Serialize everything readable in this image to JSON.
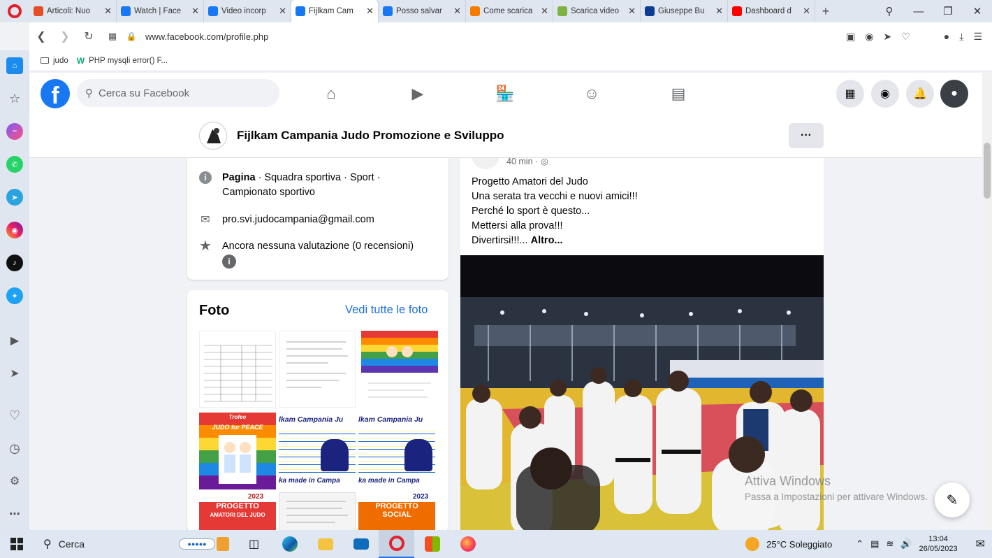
{
  "browser": {
    "tabs": [
      {
        "title": "Articoli: Nuo",
        "favicon": "joomla-icon",
        "color": "#e44d26",
        "active": false
      },
      {
        "title": "Watch | Face",
        "favicon": "facebook-icon",
        "color": "#1877f2",
        "active": false
      },
      {
        "title": "Video incorp",
        "favicon": "facebook-icon",
        "color": "#1877f2",
        "active": false
      },
      {
        "title": "Fijlkam Cam",
        "favicon": "facebook-icon",
        "color": "#1877f2",
        "active": true
      },
      {
        "title": "Posso salvar",
        "favicon": "facebook-icon",
        "color": "#1877f2",
        "active": false
      },
      {
        "title": "Come scarica",
        "favicon": "a-icon",
        "color": "#f57c00",
        "active": false
      },
      {
        "title": "Scarica video",
        "favicon": "android-icon",
        "color": "#7cb342",
        "active": false
      },
      {
        "title": "Giuseppe Bu",
        "favicon": "rai-icon",
        "color": "#0b3d91",
        "active": false
      },
      {
        "title": "Dashboard d",
        "favicon": "youtube-icon",
        "color": "#ff0000",
        "active": false
      }
    ],
    "url": "www.facebook.com/profile.php",
    "bookmarks": [
      {
        "label": "judo",
        "icon": "folder-icon"
      },
      {
        "label": "PHP mysqli error() F...",
        "icon": "w3schools-icon"
      }
    ]
  },
  "facebook": {
    "search_placeholder": "Cerca su Facebook",
    "page_name": "Fijlkam Campania Judo Promozione e Sviluppo",
    "info": {
      "category_bold": "Pagina",
      "category_rest": " · Squadra sportiva · Sport ·",
      "category_line2": "Campionato sportivo",
      "email": "pro.svi.judocampania@gmail.com",
      "rating": "Ancora nessuna valutazione (0 recensioni)"
    },
    "photos": {
      "title": "Foto",
      "see_all": "Vedi tutte le foto",
      "thumb_texts": [
        "Trofeo",
        "JUDO for PEACE",
        "lkam Campania Ju",
        "lkam Campania Ju",
        "PROGETTO",
        "AMATORI DEL JUDO",
        "PROGETTO",
        "SOCIAL",
        "2023",
        "2023",
        "ka made in Campa",
        "ka made in Campa"
      ]
    },
    "post": {
      "time": "40 min ·",
      "lines": [
        "Progetto Amatori del Judo",
        "Una serata tra vecchi e nuovi amici!!!",
        "Perché lo sport è questo...",
        "Mettersi alla prova!!!",
        "Divertirsi!!!..."
      ],
      "more": "Altro..."
    }
  },
  "watermark": {
    "line1": "Attiva Windows",
    "line2": "Passa a Impostazioni per attivare Windows."
  },
  "taskbar": {
    "search": "Cerca",
    "weather": "25°C  Soleggiato",
    "time": "13:04",
    "date": "26/05/2023"
  }
}
